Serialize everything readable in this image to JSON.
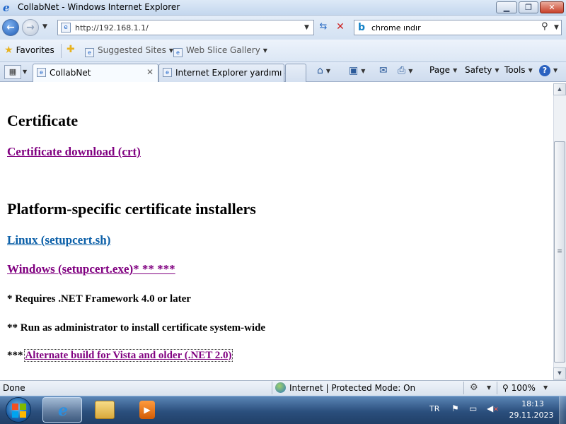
{
  "window": {
    "title": "CollabNet - Windows Internet Explorer"
  },
  "address": {
    "url": "http://192.168.1.1/"
  },
  "search": {
    "query": "chrome ındır"
  },
  "favorites_bar": {
    "favorites_label": "Favorites",
    "suggested_sites": "Suggested Sites",
    "web_slice_gallery": "Web Slice Gallery"
  },
  "tabs": [
    {
      "label": "CollabNet",
      "active": true
    },
    {
      "label": "Internet Explorer yardımı - ...",
      "active": false
    }
  ],
  "command_bar": {
    "page": "Page",
    "safety": "Safety",
    "tools": "Tools"
  },
  "content": {
    "heading_certificate": "Certificate",
    "link_certificate": "Certificate download (crt)",
    "heading_platform": "Platform-specific certificate installers",
    "link_linux": "Linux (setupcert.sh)",
    "link_windows": "Windows (setupcert.exe)* ** ***",
    "note_1": "* Requires .NET Framework 4.0 or later",
    "note_2": "** Run as administrator to install certificate system-wide",
    "note_3_prefix": "***",
    "link_alternate": "Alternate build for Vista and older (.NET 2.0)"
  },
  "status_bar": {
    "status": "Done",
    "zone": "Internet | Protected Mode: On",
    "zoom": "100%"
  },
  "taskbar": {
    "language": "TR",
    "time": "18:13",
    "date": "29.11.2023"
  },
  "colors": {
    "visited_link": "#800080",
    "link": "#0b5fa8"
  }
}
